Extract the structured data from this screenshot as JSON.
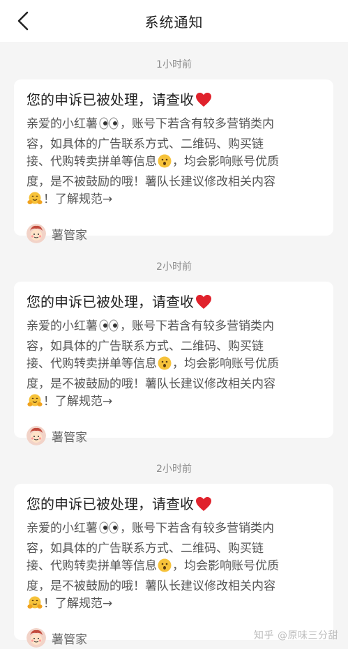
{
  "header": {
    "title": "系统通知"
  },
  "notifications": [
    {
      "time": "1小时前",
      "title": "您的申诉已被处理，请查收",
      "body": {
        "l1_a": "亲爱的小红薯",
        "l1_b": "，账号下若含有较多营销类内",
        "l2": "容，如具体的广告联系方式、二维码、购买链",
        "l3_a": "接、代购转卖拼单等信息",
        "l3_b": "，均会影响账号优质",
        "l4": "度，是不被鼓励的哦！薯队长建议修改相关内容",
        "l5": "！了解规范→"
      },
      "sender": "薯管家"
    },
    {
      "time": "2小时前",
      "title": "您的申诉已被处理，请查收",
      "body": {
        "l1_a": "亲爱的小红薯",
        "l1_b": "，账号下若含有较多营销类内",
        "l2": "容，如具体的广告联系方式、二维码、购买链",
        "l3_a": "接、代购转卖拼单等信息",
        "l3_b": "，均会影响账号优质",
        "l4": "度，是不被鼓励的哦！薯队长建议修改相关内容",
        "l5": "！了解规范→"
      },
      "sender": "薯管家"
    },
    {
      "time": "2小时前",
      "title": "您的申诉已被处理，请查收",
      "body": {
        "l1_a": "亲爱的小红薯",
        "l1_b": "，账号下若含有较多营销类内",
        "l2": "容，如具体的广告联系方式、二维码、购买链",
        "l3_a": "接、代购转卖拼单等信息",
        "l3_b": "，均会影响账号优质",
        "l4": "度，是不被鼓励的哦！薯队长建议修改相关内容",
        "l5": "！了解规范→"
      },
      "sender": "薯管家"
    }
  ],
  "watermark": "知乎 @原味三分甜",
  "icons": {
    "back": "chevron-left-icon",
    "heart": "red-heart-icon",
    "eyes": "eyes-emoji-icon",
    "surprised": "surprised-face-emoji-icon",
    "hug": "hugging-face-emoji-icon",
    "avatar": "shuguanjia-avatar"
  },
  "colors": {
    "heart": "#e0222c",
    "emoji_yellow": "#f6c23a"
  }
}
